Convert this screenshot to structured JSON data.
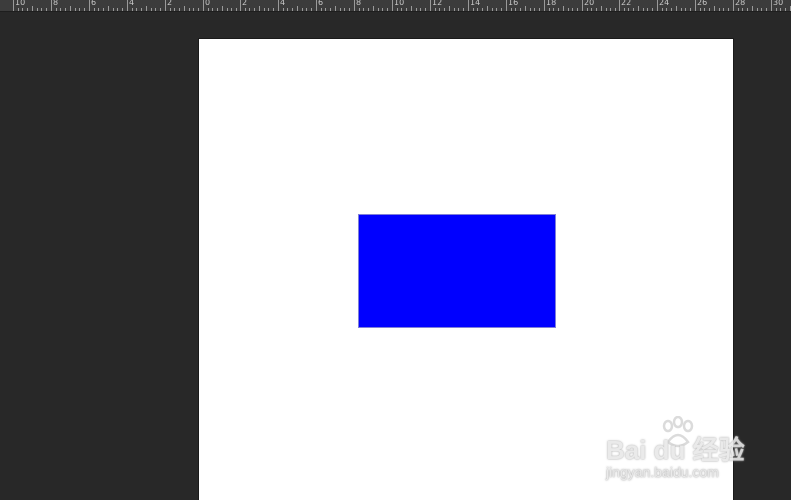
{
  "ruler": {
    "labels": [
      "10",
      "8",
      "6",
      "4",
      "2",
      "0",
      "2",
      "4",
      "6",
      "8",
      "10",
      "12",
      "14",
      "16",
      "18",
      "20",
      "22",
      "24",
      "26",
      "28",
      "30"
    ]
  },
  "document": {
    "background": "#ffffff",
    "shape": {
      "type": "rectangle",
      "fill": "#0000ff"
    }
  },
  "colors": {
    "workspace": "#282828",
    "ruler": "#3c3c3c"
  },
  "watermark": {
    "logo": "Bai du 经验",
    "url": "jingyan.baidu.com"
  }
}
